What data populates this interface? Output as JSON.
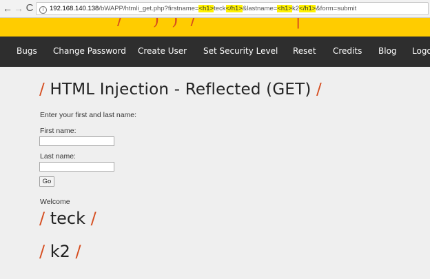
{
  "browser": {
    "back_glyph": "←",
    "forward_glyph": "→",
    "reload_glyph": "C",
    "url": {
      "host": "192.168.140.138",
      "path": "/bWAPP/htmli_get.php?firstname=",
      "tag_open_1": "<h1>",
      "value_1": "teck",
      "tag_close_1": "</h1>",
      "mid": "&lastname=",
      "tag_open_2": "<h1>",
      "value_2": "k2",
      "tag_close_2": "</h1>",
      "tail": "&form=submit"
    },
    "highlight_color": "#fff200"
  },
  "menu": {
    "items": [
      {
        "label": "Bugs"
      },
      {
        "label": "Change Password"
      },
      {
        "label": "Create User"
      },
      {
        "label": "Set Security Level"
      },
      {
        "label": "Reset"
      },
      {
        "label": "Credits"
      },
      {
        "label": "Blog"
      },
      {
        "label": "Logout"
      }
    ]
  },
  "colors": {
    "header_band": "#ffcc00",
    "menu_bar": "#2e2e2e",
    "slash_accent": "#d64d1f",
    "page_background": "#efefef"
  },
  "page": {
    "title": "HTML Injection - Reflected (GET)",
    "slash": "/",
    "prompt": "Enter your first and last name:",
    "first_name_label": "First name:",
    "first_name_value": "",
    "last_name_label": "Last name:",
    "last_name_value": "",
    "go_label": "Go",
    "welcome": "Welcome",
    "reflected_first": "teck",
    "reflected_last": "k2"
  }
}
